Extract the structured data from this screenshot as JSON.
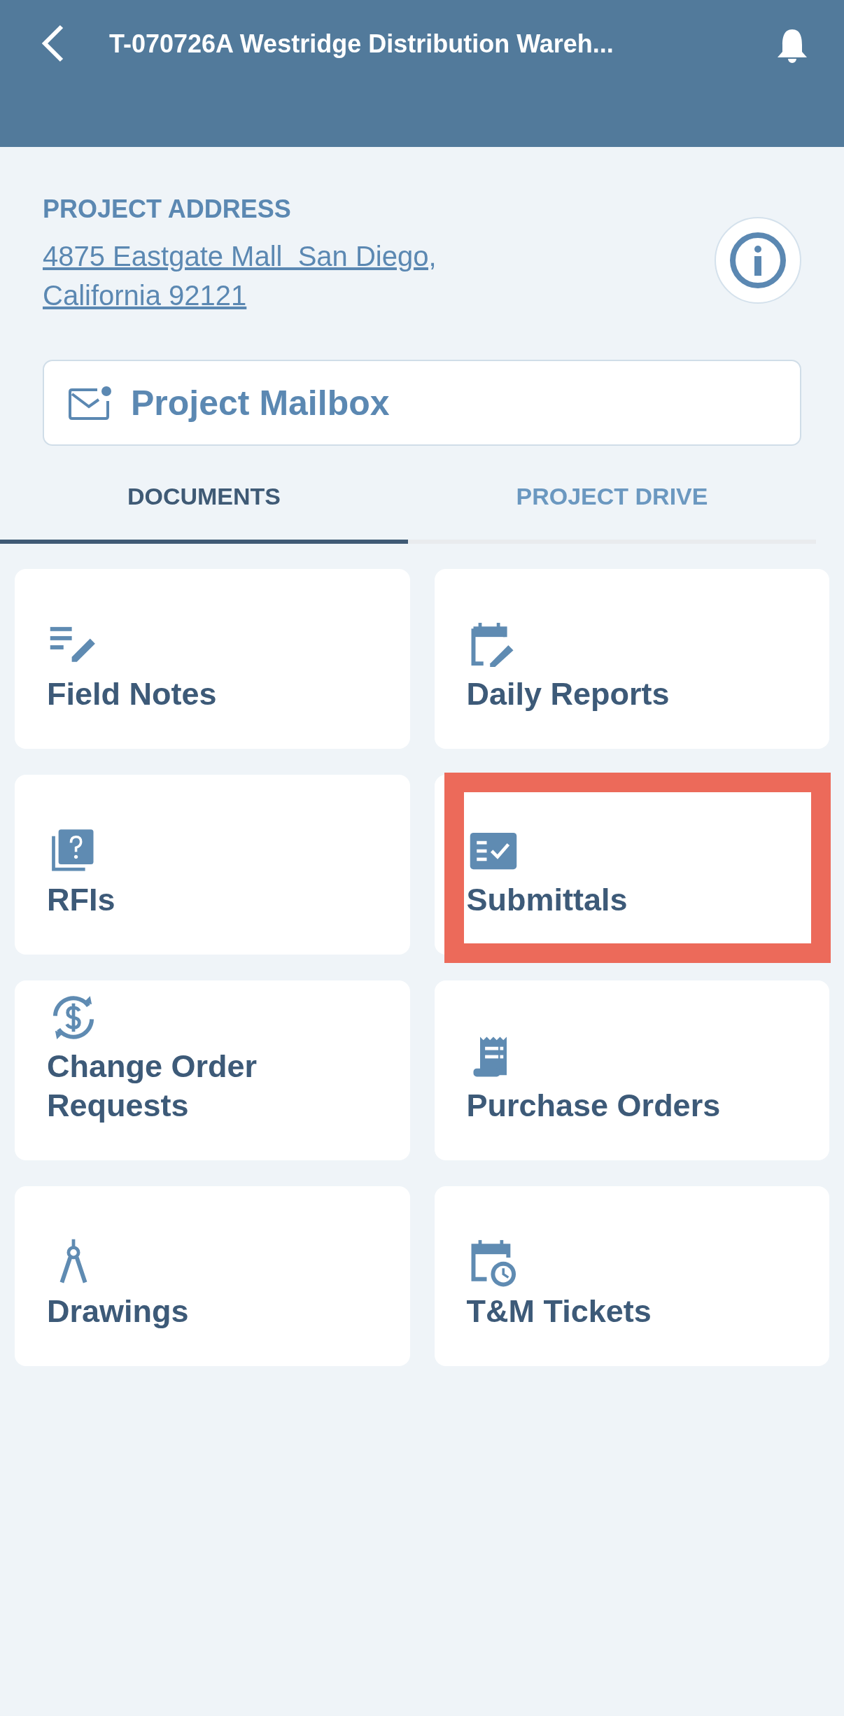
{
  "header": {
    "title": "T-070726A Westridge Distribution Wareh..."
  },
  "project_address": {
    "label": "PROJECT ADDRESS",
    "address_lines": [
      "4875 Eastgate Mall  San Diego,",
      "California 92121"
    ]
  },
  "mailbox_button": {
    "label": "Project Mailbox"
  },
  "tabs": [
    {
      "label": "DOCUMENTS",
      "selected": true
    },
    {
      "label": "PROJECT DRIVE",
      "selected": false
    }
  ],
  "tiles": [
    {
      "kind": "notes",
      "label": "Field Notes",
      "highlighted": false
    },
    {
      "kind": "calendar-edit",
      "label": "Daily Reports",
      "highlighted": false
    },
    {
      "kind": "question",
      "label": "RFIs",
      "highlighted": false
    },
    {
      "kind": "checklist",
      "label": "Submittals",
      "highlighted": true
    },
    {
      "kind": "dollar",
      "label": "Change Order Requests",
      "highlighted": false
    },
    {
      "kind": "receipt",
      "label": "Purchase Orders",
      "highlighted": false
    },
    {
      "kind": "compass",
      "label": "Drawings",
      "highlighted": false
    },
    {
      "kind": "calendar-clock",
      "label": "T&M Tickets",
      "highlighted": false
    }
  ]
}
